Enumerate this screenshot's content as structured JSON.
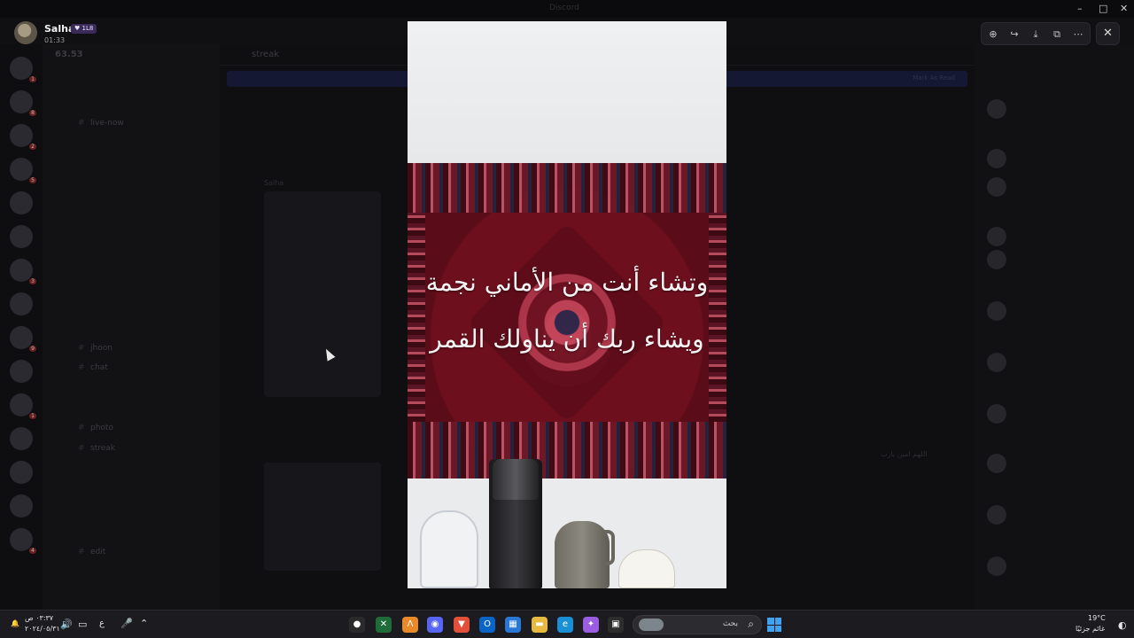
{
  "window": {
    "title": "Discord"
  },
  "viewer": {
    "user_name": "Salha",
    "badge": "1L8",
    "timestamp": "01:33",
    "tools": [
      "zoom-in-icon",
      "forward-icon",
      "download-icon",
      "open-external-icon",
      "more-icon"
    ],
    "close_icon": "close-icon"
  },
  "media": {
    "caption_line1": "وتشاء أنت من الأماني نجمة",
    "caption_line2": "ويشاء ربك أن يناولك القمر"
  },
  "background": {
    "server_label": "63.53",
    "channel_header": "streak",
    "channels": [
      "live-now",
      "jhoon",
      "chat",
      "photo",
      "streak",
      "edit"
    ],
    "chat_author": "Salha",
    "pinned": "Mark As Read",
    "side_text": "اللهم امين يارب"
  },
  "taskbar": {
    "time": "٠٣:٣٧ ص",
    "date": "٢٠٢٤/٠٥/٣١",
    "lang": "ع",
    "search_placeholder": "بحث",
    "weather_temp": "19°C",
    "weather_desc": "غائم جزئيًا"
  },
  "colors": {
    "accent": "#3fa3f2",
    "viewer_bg": "#0b0b0d",
    "rug": "#6e0f1d"
  }
}
